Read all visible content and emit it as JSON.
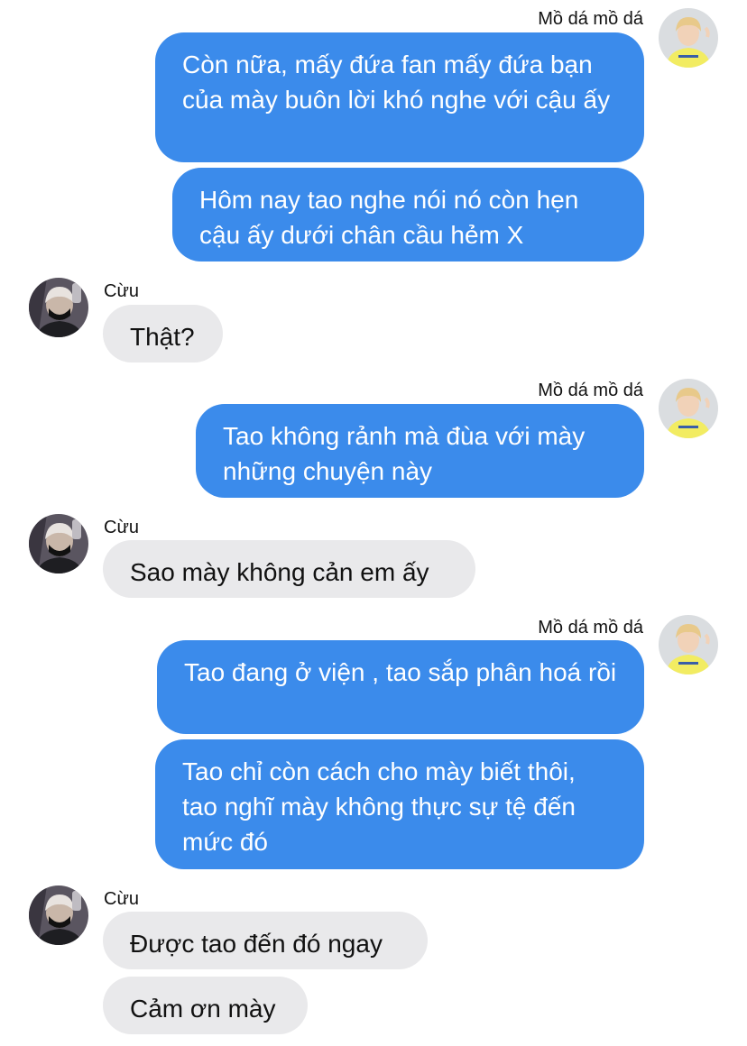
{
  "participants": {
    "me": {
      "name": "Mồ dá mồ dá",
      "avatar_icon": "user-avatar-blond-yellow-shirt-icon"
    },
    "them": {
      "name": "Cừu",
      "avatar_icon": "user-avatar-dark-masked-icon"
    }
  },
  "colors": {
    "outgoing_bubble": "#3b8beb",
    "incoming_bubble": "#e9e9eb",
    "outgoing_text": "#ffffff",
    "incoming_text": "#111111"
  },
  "groups": [
    {
      "sender": "Mồ dá mồ dá",
      "messages": [
        "Còn nữa, mấy đứa fan mấy đứa bạn của mày buôn lời khó nghe với cậu ấy",
        "Hôm nay tao nghe nói nó còn hẹn cậu ấy dưới chân cầu hẻm X"
      ]
    },
    {
      "sender": "Cừu",
      "messages": [
        "Thật?"
      ]
    },
    {
      "sender": "Mồ dá mồ dá",
      "messages": [
        "Tao không rảnh mà đùa với mày những chuyện này"
      ]
    },
    {
      "sender": "Cừu",
      "messages": [
        "Sao mày không cản em ấy"
      ]
    },
    {
      "sender": "Mồ dá mồ dá",
      "messages": [
        "Tao đang ở viện , tao sắp phân hoá rồi",
        "Tao chỉ còn cách cho mày biết thôi, tao nghĩ mày không thực sự tệ đến mức đó"
      ]
    },
    {
      "sender": "Cừu",
      "messages": [
        "Được tao đến đó ngay",
        "Cảm ơn mày"
      ]
    }
  ]
}
